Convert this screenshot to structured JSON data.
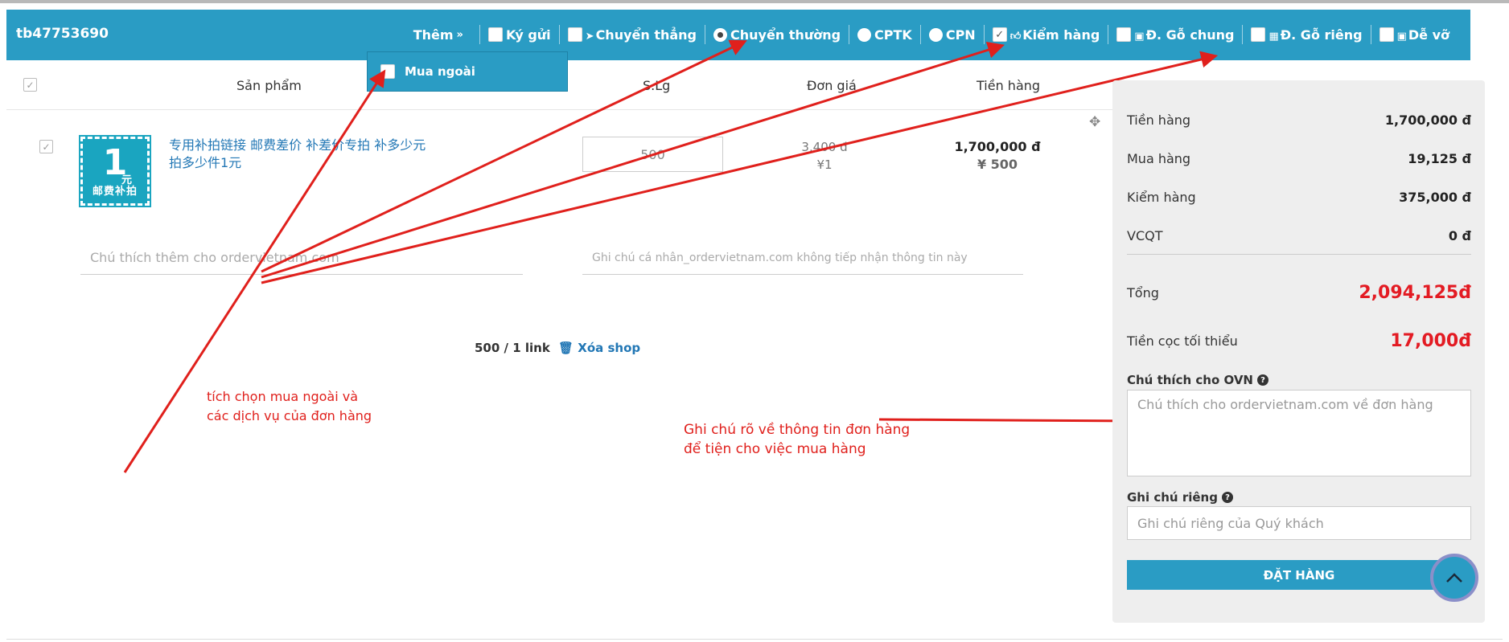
{
  "header": {
    "shop_id": "tb47753690",
    "more_label": "Thêm",
    "options": [
      {
        "label": "Ký gửi",
        "type": "checkbox",
        "checked": false,
        "icon": ""
      },
      {
        "label": "Chuyển thẳng",
        "type": "checkbox",
        "checked": false,
        "icon": "rocket-icon"
      },
      {
        "label": "Chuyển thường",
        "type": "radio",
        "checked": true,
        "icon": ""
      },
      {
        "label": "CPTK",
        "type": "radio",
        "checked": false,
        "icon": ""
      },
      {
        "label": "CPN",
        "type": "radio",
        "checked": false,
        "icon": ""
      },
      {
        "label": "Kiểm hàng",
        "type": "checkbox",
        "checked": true,
        "icon": "thumbs-up-icon"
      },
      {
        "label": "Đ. Gỗ chung",
        "type": "checkbox",
        "checked": false,
        "icon": "box-icon"
      },
      {
        "label": "Đ. Gỗ riêng",
        "type": "checkbox",
        "checked": false,
        "icon": "boxes-icon"
      },
      {
        "label": "Dễ vỡ",
        "type": "checkbox",
        "checked": false,
        "icon": "box-icon"
      }
    ]
  },
  "dropdown": {
    "mua_ngoai_label": "Mua ngoài"
  },
  "table": {
    "col_product": "Sản phẩm",
    "col_qty": "S.Lg",
    "col_price": "Đơn giá",
    "col_amount": "Tiền hàng"
  },
  "product": {
    "thumb_big": "1",
    "thumb_yuan": "元",
    "thumb_caption": "邮费补拍",
    "name": "专用补拍链接 邮费差价 补差价专拍 补多少元拍多少件1元",
    "qty": "500",
    "price_vnd": "3,400 đ",
    "price_cny": "¥1",
    "amount_vnd": "1,700,000 đ",
    "amount_cny": "¥ 500",
    "note_placeholder": "Chú thích thêm cho ordervietnam.com",
    "private_note_placeholder": "Ghi chú cá nhân_ordervietnam.com không tiếp nhận thông tin này"
  },
  "shop_footer": {
    "count": "500 / 1 link",
    "delete_label": "Xóa shop"
  },
  "annotations": {
    "left_line1": "tích chọn mua ngoài và",
    "left_line2": "các dịch vụ của đơn hàng",
    "right_line1": "Ghi chú rõ về thông tin đơn hàng",
    "right_line2": "để tiện cho việc mua hàng"
  },
  "summary": {
    "rows": [
      {
        "label": "Tiền hàng",
        "value": "1,700,000 đ"
      },
      {
        "label": "Mua hàng",
        "value": "19,125 đ"
      },
      {
        "label": "Kiểm hàng",
        "value": "375,000 đ"
      },
      {
        "label": "VCQT",
        "value": "0 đ"
      }
    ],
    "total_label": "Tổng",
    "total_value": "2,094,125đ",
    "deposit_label": "Tiền cọc tối thiểu",
    "deposit_value": "17,000đ",
    "ovn_note_label": "Chú thích cho OVN",
    "ovn_note_placeholder": "Chú thích cho ordervietnam.com về đơn hàng",
    "private_label": "Ghi chú riêng",
    "private_placeholder": "Ghi chú riêng của Quý khách",
    "order_button": "ĐẶT HÀNG"
  },
  "colors": {
    "header_bg": "#2a9cc4",
    "accent_red": "#e31b23",
    "annotation_red": "#e0201c"
  }
}
